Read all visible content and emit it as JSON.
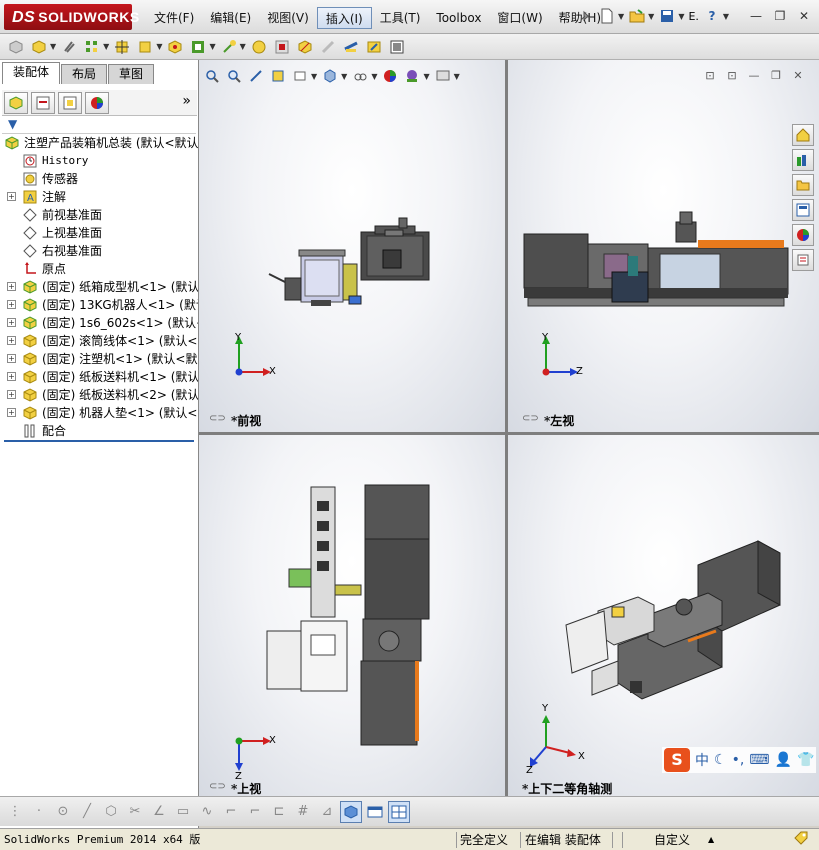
{
  "app": {
    "logo_prefix": "DS",
    "logo_text": "SOLIDWORKS"
  },
  "menu": [
    {
      "label": "文件(F)"
    },
    {
      "label": "编辑(E)"
    },
    {
      "label": "视图(V)"
    },
    {
      "label": "插入(I)",
      "active": true
    },
    {
      "label": "工具(T)"
    },
    {
      "label": "Toolbox"
    },
    {
      "label": "窗口(W)"
    },
    {
      "label": "帮助(H)"
    }
  ],
  "title_tools_extra": "E.",
  "panel": {
    "tabs": [
      "装配体",
      "布局",
      "草图"
    ],
    "expand": "»"
  },
  "tree": [
    {
      "label": "注塑产品装箱机总装  (默认<默认",
      "icon": "assembly-icon",
      "indent": 0,
      "expandable": false
    },
    {
      "label": "History",
      "icon": "history-icon",
      "indent": 1,
      "mono": true
    },
    {
      "label": "传感器",
      "icon": "sensor-icon",
      "indent": 1
    },
    {
      "label": "注解",
      "icon": "annotation-icon",
      "indent": 1,
      "expandable": true
    },
    {
      "label": "前视基准面",
      "icon": "plane-icon",
      "indent": 1
    },
    {
      "label": "上视基准面",
      "icon": "plane-icon",
      "indent": 1
    },
    {
      "label": "右视基准面",
      "icon": "plane-icon",
      "indent": 1
    },
    {
      "label": "原点",
      "icon": "origin-icon",
      "indent": 1
    },
    {
      "label": "(固定) 纸箱成型机<1> (默认<",
      "icon": "subassembly-icon",
      "indent": 1,
      "expandable": true
    },
    {
      "label": "(固定) 13KG机器人<1> (默认<",
      "icon": "subassembly-icon",
      "indent": 1,
      "expandable": true
    },
    {
      "label": "(固定) 1s6_602s<1> (默认<默",
      "icon": "subassembly-icon",
      "indent": 1,
      "expandable": true
    },
    {
      "label": "(固定) 滚筒线体<1> (默认<",
      "icon": "part-icon",
      "indent": 1,
      "expandable": true
    },
    {
      "label": "(固定) 注塑机<1> (默认<默",
      "icon": "part-icon",
      "indent": 1,
      "expandable": true
    },
    {
      "label": "(固定) 纸板送料机<1> (默认",
      "icon": "part-icon",
      "indent": 1,
      "expandable": true
    },
    {
      "label": "(固定) 纸板送料机<2> (默认",
      "icon": "part-icon",
      "indent": 1,
      "expandable": true
    },
    {
      "label": "(固定) 机器人垫<1> (默认<",
      "icon": "part-icon",
      "indent": 1,
      "expandable": true
    },
    {
      "label": "配合",
      "icon": "mates-icon",
      "indent": 1
    }
  ],
  "viewports": {
    "front": {
      "label": "*前视",
      "axis_x": "X",
      "axis_y": "Y"
    },
    "left": {
      "label": "*左视",
      "axis_z": "Z",
      "axis_y": "Y"
    },
    "top": {
      "label": "*上视",
      "axis_x": "X",
      "axis_z": "Z"
    },
    "iso": {
      "label": "*上下二等角轴测",
      "axis_x": "X",
      "axis_y": "Y",
      "axis_z": "Z"
    }
  },
  "status": {
    "product": "SolidWorks Premium 2014 x64 版",
    "definition": "完全定义",
    "mode": "在编辑 装配体",
    "units": "自定义",
    "units_arrow": "▲"
  },
  "ime": {
    "logo": "S",
    "lang": "中"
  },
  "colors": {
    "brand_red": "#c4161c",
    "machine_gray": "#5a5a5a",
    "accent_orange": "#e87a1c",
    "axis_red": "#d02020",
    "axis_green": "#20a020",
    "axis_blue": "#2040d0"
  }
}
